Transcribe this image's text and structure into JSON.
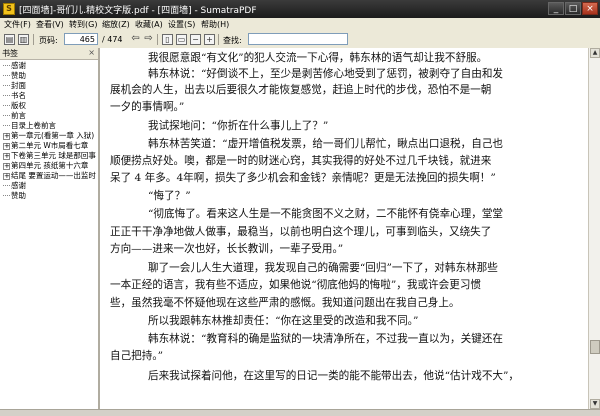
{
  "window": {
    "app_icon": "sumatra-app-icon",
    "title": "[四面墙]-哥们儿.精校文字版.pdf - [四面墙] - SumatraPDF",
    "minimize": "_",
    "maximize": "□",
    "close": "×"
  },
  "menu": [
    "文件(F)",
    "查看(V)",
    "转到(G)",
    "缩放(Z)",
    "收藏(A)",
    "设置(S)",
    "帮助(H)"
  ],
  "toolbar": {
    "page_label": "页码:",
    "page_value": "465",
    "page_total": "/ 474",
    "find_label": "查找:",
    "find_value": "",
    "icons": [
      "open-icon",
      "print-icon",
      "previous-page-icon",
      "next-page-icon",
      "fit-page-icon",
      "fit-width-icon",
      "zoom-out-icon",
      "zoom-in-icon"
    ]
  },
  "sidebar": {
    "header": "书签",
    "close": "×",
    "items": [
      {
        "label": "感谢",
        "expander": ""
      },
      {
        "label": "赞助",
        "expander": ""
      },
      {
        "label": "封面",
        "expander": ""
      },
      {
        "label": "书名",
        "expander": ""
      },
      {
        "label": "版权",
        "expander": ""
      },
      {
        "label": "前言",
        "expander": ""
      },
      {
        "label": "目录上卷前言",
        "expander": ""
      },
      {
        "label": "第一章元(看第一章 入狱)",
        "expander": "+"
      },
      {
        "label": "第二单元 W市局看七章",
        "expander": "+"
      },
      {
        "label": "下卷第三单元 球是那回事",
        "expander": "+"
      },
      {
        "label": "第四单元 孩纸第十六章",
        "expander": "+"
      },
      {
        "label": "结尾 要置运动——出监时",
        "expander": "+"
      },
      {
        "label": "感谢",
        "expander": ""
      },
      {
        "label": "赞助",
        "expander": ""
      }
    ]
  },
  "document": {
    "lines": [
      "我很愿意跟“有文化”的犯人交流一下心得，韩东林的语气却让我不舒服。",
      "韩东林说：“好倒谈不上，至少是剥苦修心地受到了惩罚，被剥夺了自由和发",
      "展机会的人生，出去以后要很久才能恢复感觉，赶追上时代的步伐，恐怕不是一朝",
      "一夕的事情啊。”",
      "我试探地问：“你折在什么事儿上了？”",
      "韩东林苦笑道：“虚开增值税发票，给一哥们儿帮忙，瞅点出口退税，自己也",
      "顺便捞点好处。噢，都是一时的财迷心窍，其实我得的好处不过几千块钱，就进来",
      "呆了 4 年多。4年啊，损失了多少机会和金钱？亲情呢？更是无法挽回的损失啊！”",
      "“悔了？”",
      "“彻底悔了。看来这人生是一不能贪图不义之财，二不能怀有侥幸心理，堂堂",
      "正正干干净净地做人做事，最稳当，以前也明白这个理儿，可事到临头，又绕失了",
      "方向——进来一次也好，长长教训，一辈子受用。”",
      "聊了一会儿人生大道理，我发现自己的确需要“回归”一下了，对韩东林那些",
      "一本正经的语言，我有些不适应，如果他说“彻底他妈的悔啦”，我或许会更习惯",
      "些，虽然我毫不怀疑他现在这些严肃的感慨。我知道问题出在我自己身上。",
      "所以我跟韩东林推却责任：“你在这里受的改造和我不同。”",
      "韩东林说：“教育科的确是监狱的一块清净所在，不过我一直以为，关键还在",
      "自己把持。”",
      "后来我试探着问他，在这里写的日记一类的能不能带出去，他说“估计戏不大”，"
    ]
  }
}
